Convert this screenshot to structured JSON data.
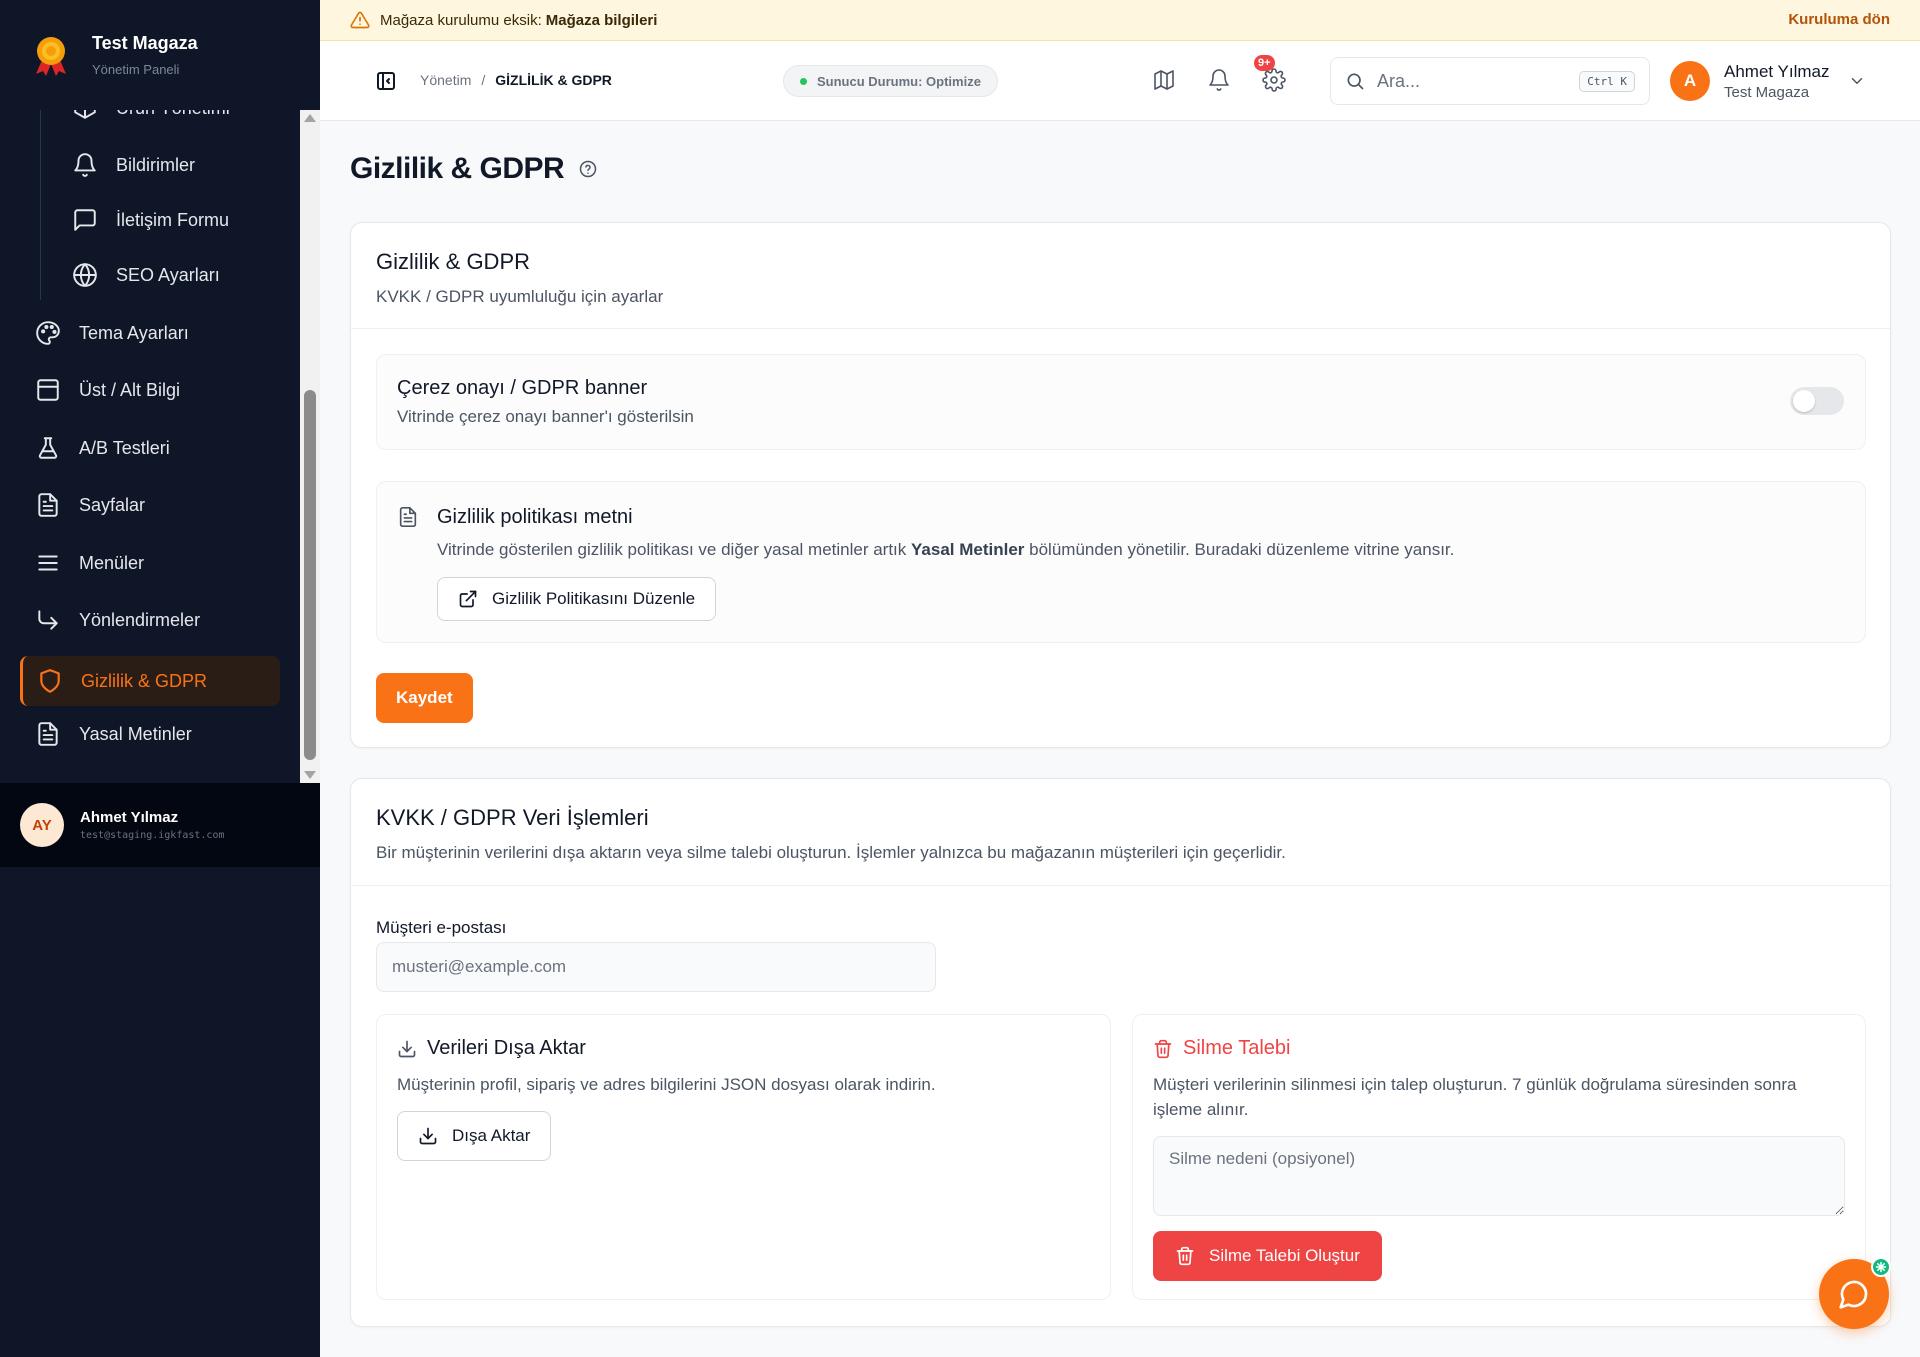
{
  "brand": {
    "name": "Test Magaza",
    "subtitle": "Yönetim Paneli"
  },
  "sidebar": {
    "subitems": [
      {
        "label": "Ürün Yönetimi",
        "icon": "box-icon"
      },
      {
        "label": "Bildirimler",
        "icon": "bell-icon"
      },
      {
        "label": "İletişim Formu",
        "icon": "message-square-icon"
      },
      {
        "label": "SEO Ayarları",
        "icon": "globe-icon"
      }
    ],
    "items": [
      {
        "label": "Tema Ayarları",
        "icon": "palette-icon"
      },
      {
        "label": "Üst / Alt Bilgi",
        "icon": "layout-icon"
      },
      {
        "label": "A/B Testleri",
        "icon": "flask-icon"
      },
      {
        "label": "Sayfalar",
        "icon": "file-text-icon"
      },
      {
        "label": "Menüler",
        "icon": "menu-icon"
      },
      {
        "label": "Yönlendirmeler",
        "icon": "corner-down-right-icon"
      },
      {
        "label": "Gizlilik & GDPR",
        "icon": "shield-icon",
        "active": true
      },
      {
        "label": "Yasal Metinler",
        "icon": "file-text-icon"
      }
    ],
    "user": {
      "initials": "AY",
      "name": "Ahmet Yılmaz",
      "email": "test@staging.igkfast.com"
    }
  },
  "banner": {
    "text": "Mağaza kurulumu eksik:",
    "highlight": "Mağaza bilgileri",
    "action": "Kuruluma dön"
  },
  "header": {
    "breadcrumb": {
      "root": "Yönetim",
      "sep": "/",
      "current": "GİZLİLİK & GDPR"
    },
    "server_status": "Sunucu Durumu: Optimize",
    "notifications_badge": "9+",
    "search": {
      "placeholder": "Ara...",
      "shortcut": "Ctrl K"
    },
    "profile": {
      "initial": "A",
      "name": "Ahmet Yılmaz",
      "store": "Test Magaza"
    }
  },
  "page": {
    "title": "Gizlilik & GDPR"
  },
  "privacy_card": {
    "title": "Gizlilik & GDPR",
    "subtitle": "KVKK / GDPR uyumluluğu için ayarlar",
    "cookie": {
      "title": "Çerez onayı / GDPR banner",
      "description": "Vitrinde çerez onayı banner'ı gösterilsin",
      "enabled": false
    },
    "policy": {
      "title": "Gizlilik politikası metni",
      "desc_before": "Vitrinde gösterilen gizlilik politikası ve diğer yasal metinler artık",
      "desc_bold": "Yasal Metinler",
      "desc_after": "bölümünden yönetilir. Buradaki düzenleme vitrine yansır.",
      "button": "Gizlilik Politikasını Düzenle"
    },
    "save_button": "Kaydet"
  },
  "data_card": {
    "title": "KVKK / GDPR Veri İşlemleri",
    "subtitle": "Bir müşterinin verilerini dışa aktarın veya silme talebi oluşturun. İşlemler yalnızca bu mağazanın müşterileri için geçerlidir.",
    "email_label": "Müşteri e-postası",
    "email_placeholder": "musteri@example.com",
    "export": {
      "title": "Verileri Dışa Aktar",
      "description": "Müşterinin profil, sipariş ve adres bilgilerini JSON dosyası olarak indirin.",
      "button": "Dışa Aktar"
    },
    "delete": {
      "title": "Silme Talebi",
      "description": "Müşteri verilerinin silinmesi için talep oluşturun. 7 günlük doğrulama süresinden sonra işleme alınır.",
      "reason_placeholder": "Silme nedeni (opsiyonel)",
      "button": "Silme Talebi Oluştur"
    }
  },
  "colors": {
    "accent": "#f97316",
    "danger": "#ef4444",
    "sidebar_bg": "#0e1627",
    "success": "#22c55e"
  }
}
